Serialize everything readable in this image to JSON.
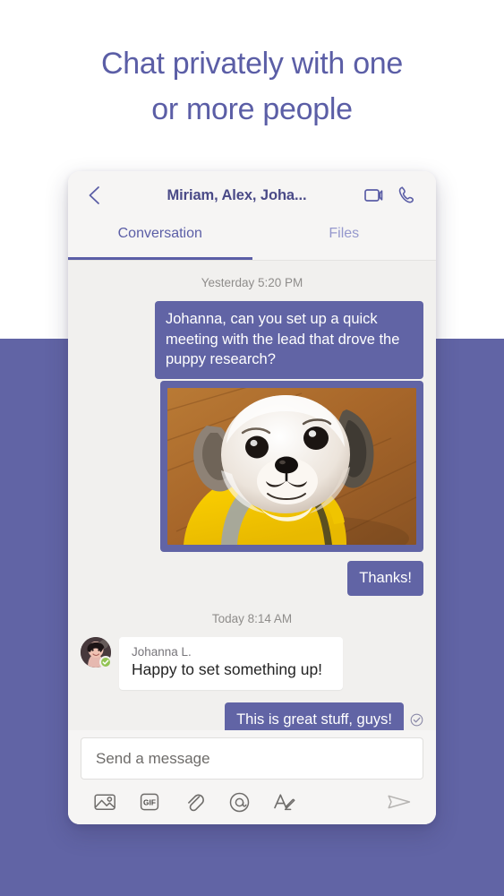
{
  "headline": {
    "line1": "Chat privately with one",
    "line2": "or more people"
  },
  "colors": {
    "brand_purple": "#6164a5",
    "headline_purple": "#5b5ea6",
    "tab_inactive": "#9598cd",
    "band": "#6164a5",
    "convo_bg": "#f1f0ee",
    "card_bg": "#f6f5f4",
    "presence_green": "#92c353"
  },
  "header": {
    "back_icon": "chevron-left-icon",
    "title": "Miriam, Alex, Joha...",
    "video_call_icon": "video-camera-icon",
    "audio_call_icon": "phone-icon"
  },
  "tabs": [
    {
      "label": "Conversation",
      "active": true
    },
    {
      "label": "Files",
      "active": false
    }
  ],
  "conversation": {
    "groups": [
      {
        "timestamp": "Yesterday 5:20 PM",
        "messages": [
          {
            "direction": "outgoing",
            "type": "text",
            "text": "Johanna, can you set up a quick meeting with the lead that drove the puppy research?"
          },
          {
            "direction": "outgoing",
            "type": "image",
            "alt": "Shih Tzu puppy wearing a yellow raincoat on a wooden floor"
          },
          {
            "direction": "outgoing",
            "type": "text",
            "text": "Thanks!"
          }
        ]
      },
      {
        "timestamp": "Today 8:14 AM",
        "messages": [
          {
            "direction": "incoming",
            "type": "text",
            "sender": "Johanna L.",
            "text": "Happy to set something up!",
            "presence": "available"
          },
          {
            "direction": "outgoing",
            "type": "text",
            "text": "This is great stuff, guys!",
            "status_icon": "check-circle-icon"
          }
        ]
      }
    ]
  },
  "composer": {
    "placeholder": "Send a message",
    "value": "",
    "tools": [
      {
        "name": "image-icon",
        "label": ""
      },
      {
        "name": "gif-icon",
        "label": "GIF"
      },
      {
        "name": "attachment-icon",
        "label": ""
      },
      {
        "name": "mention-icon",
        "label": ""
      },
      {
        "name": "format-text-icon",
        "label": ""
      }
    ],
    "send_icon": "send-icon"
  }
}
